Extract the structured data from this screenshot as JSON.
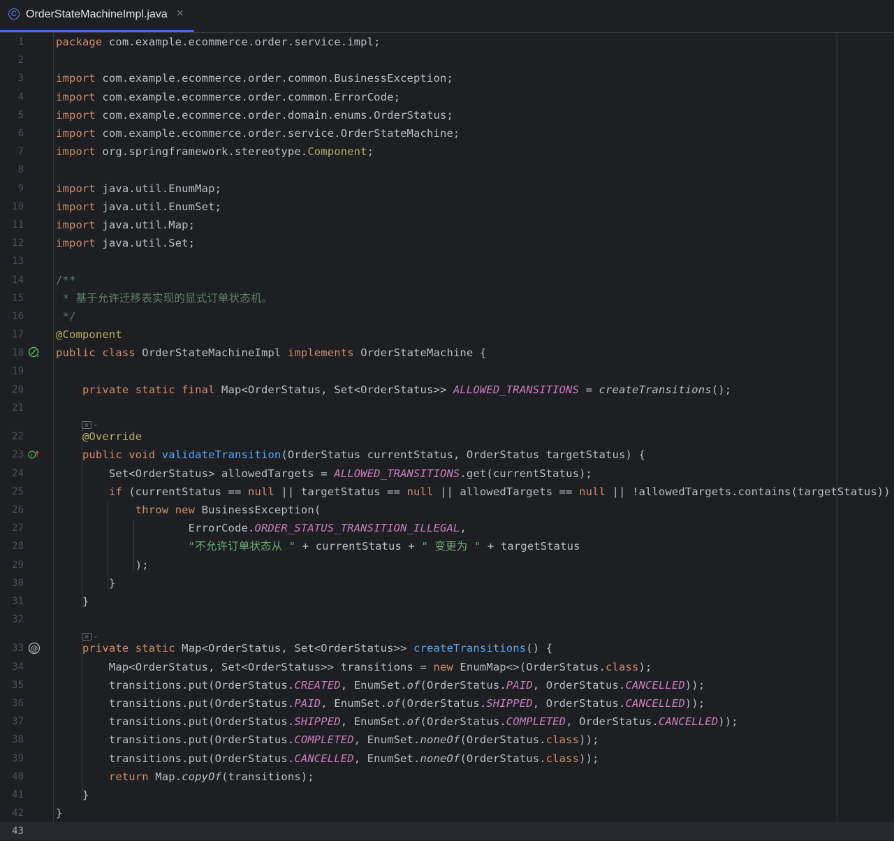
{
  "tab": {
    "icon": "C",
    "title": "OrderStateMachineImpl.java",
    "close": "×"
  },
  "editor": {
    "current_line": 43,
    "lines": [
      {
        "n": 1,
        "t": [
          [
            "kw",
            "package"
          ],
          [
            "p",
            " com.example.ecommerce.order.service.impl;"
          ]
        ]
      },
      {
        "n": 2,
        "t": []
      },
      {
        "n": 3,
        "t": [
          [
            "kw",
            "import"
          ],
          [
            "p",
            " com.example.ecommerce.order.common.BusinessException;"
          ]
        ]
      },
      {
        "n": 4,
        "t": [
          [
            "kw",
            "import"
          ],
          [
            "p",
            " com.example.ecommerce.order.common.ErrorCode;"
          ]
        ]
      },
      {
        "n": 5,
        "t": [
          [
            "kw",
            "import"
          ],
          [
            "p",
            " com.example.ecommerce.order.domain.enums.OrderStatus;"
          ]
        ]
      },
      {
        "n": 6,
        "t": [
          [
            "kw",
            "import"
          ],
          [
            "p",
            " com.example.ecommerce.order.service.OrderStateMachine;"
          ]
        ]
      },
      {
        "n": 7,
        "t": [
          [
            "kw",
            "import"
          ],
          [
            "p",
            " org.springframework.stereotype."
          ],
          [
            "ann",
            "Component"
          ],
          [
            "p",
            ";"
          ]
        ]
      },
      {
        "n": 8,
        "t": []
      },
      {
        "n": 9,
        "t": [
          [
            "kw",
            "import"
          ],
          [
            "p",
            " java.util.EnumMap;"
          ]
        ]
      },
      {
        "n": 10,
        "t": [
          [
            "kw",
            "import"
          ],
          [
            "p",
            " java.util.EnumSet;"
          ]
        ]
      },
      {
        "n": 11,
        "t": [
          [
            "kw",
            "import"
          ],
          [
            "p",
            " java.util.Map;"
          ]
        ]
      },
      {
        "n": 12,
        "t": [
          [
            "kw",
            "import"
          ],
          [
            "p",
            " java.util.Set;"
          ]
        ]
      },
      {
        "n": 13,
        "t": []
      },
      {
        "n": 14,
        "t": [
          [
            "cmt",
            "/**"
          ]
        ]
      },
      {
        "n": 15,
        "t": [
          [
            "cmt",
            " * 基于允许迁移表实现的显式订单状态机。"
          ]
        ]
      },
      {
        "n": 16,
        "t": [
          [
            "cmt",
            " */"
          ]
        ]
      },
      {
        "n": 17,
        "t": [
          [
            "ann",
            "@Component"
          ]
        ]
      },
      {
        "n": 18,
        "t": [
          [
            "kw",
            "public class"
          ],
          [
            "p",
            " OrderStateMachineImpl "
          ],
          [
            "kw",
            "implements"
          ],
          [
            "p",
            " OrderStateMachine {"
          ]
        ],
        "gutter": "bean"
      },
      {
        "n": 19,
        "t": []
      },
      {
        "n": 20,
        "t": [
          [
            "p",
            "    "
          ],
          [
            "kw",
            "private static final"
          ],
          [
            "p",
            " Map<OrderStatus, Set<OrderStatus>> "
          ],
          [
            "const",
            "ALLOWED_TRANSITIONS"
          ],
          [
            "p",
            " = "
          ],
          [
            "it",
            "createTransitions"
          ],
          [
            "p",
            "();"
          ]
        ]
      },
      {
        "n": 21,
        "t": [],
        "hint_after": true
      },
      {
        "n": 22,
        "t": [
          [
            "p",
            "    "
          ],
          [
            "ann",
            "@Override"
          ]
        ]
      },
      {
        "n": 23,
        "t": [
          [
            "p",
            "    "
          ],
          [
            "kw",
            "public void"
          ],
          [
            "p",
            " "
          ],
          [
            "fn",
            "validateTransition"
          ],
          [
            "p",
            "(OrderStatus currentStatus, OrderStatus targetStatus) {"
          ]
        ],
        "gutter": "impl"
      },
      {
        "n": 24,
        "t": [
          [
            "p",
            "        Set<OrderStatus> allowedTargets = "
          ],
          [
            "const",
            "ALLOWED_TRANSITIONS"
          ],
          [
            "p",
            ".get(currentStatus);"
          ]
        ]
      },
      {
        "n": 25,
        "t": [
          [
            "p",
            "        "
          ],
          [
            "kw",
            "if"
          ],
          [
            "p",
            " (currentStatus == "
          ],
          [
            "kw",
            "null"
          ],
          [
            "p",
            " || targetStatus == "
          ],
          [
            "kw",
            "null"
          ],
          [
            "p",
            " || allowedTargets == "
          ],
          [
            "kw",
            "null"
          ],
          [
            "p",
            " || !allowedTargets.contains(targetStatus)) {"
          ]
        ]
      },
      {
        "n": 26,
        "t": [
          [
            "p",
            "            "
          ],
          [
            "kw",
            "throw new"
          ],
          [
            "p",
            " BusinessException("
          ]
        ]
      },
      {
        "n": 27,
        "t": [
          [
            "p",
            "                    ErrorCode."
          ],
          [
            "const",
            "ORDER_STATUS_TRANSITION_ILLEGAL"
          ],
          [
            "p",
            ","
          ]
        ]
      },
      {
        "n": 28,
        "t": [
          [
            "p",
            "                    "
          ],
          [
            "str",
            "\"不允许订单状态从 \""
          ],
          [
            "p",
            " + currentStatus + "
          ],
          [
            "str",
            "\" 变更为 \""
          ],
          [
            "p",
            " + targetStatus"
          ]
        ]
      },
      {
        "n": 29,
        "t": [
          [
            "p",
            "            );"
          ]
        ]
      },
      {
        "n": 30,
        "t": [
          [
            "p",
            "        }"
          ]
        ]
      },
      {
        "n": 31,
        "t": [
          [
            "p",
            "    }"
          ]
        ]
      },
      {
        "n": 32,
        "t": [],
        "hint_after": true
      },
      {
        "n": 33,
        "t": [
          [
            "p",
            "    "
          ],
          [
            "kw",
            "private static"
          ],
          [
            "p",
            " Map<OrderStatus, Set<OrderStatus>> "
          ],
          [
            "fn",
            "createTransitions"
          ],
          [
            "p",
            "() {"
          ]
        ],
        "gutter": "at"
      },
      {
        "n": 34,
        "t": [
          [
            "p",
            "        Map<OrderStatus, Set<OrderStatus>> transitions = "
          ],
          [
            "kw",
            "new"
          ],
          [
            "p",
            " EnumMap<>(OrderStatus."
          ],
          [
            "kw",
            "class"
          ],
          [
            "p",
            ");"
          ]
        ]
      },
      {
        "n": 35,
        "t": [
          [
            "p",
            "        transitions.put(OrderStatus."
          ],
          [
            "const",
            "CREATED"
          ],
          [
            "p",
            ", EnumSet."
          ],
          [
            "it",
            "of"
          ],
          [
            "p",
            "(OrderStatus."
          ],
          [
            "const",
            "PAID"
          ],
          [
            "p",
            ", OrderStatus."
          ],
          [
            "const",
            "CANCELLED"
          ],
          [
            "p",
            "));"
          ]
        ]
      },
      {
        "n": 36,
        "t": [
          [
            "p",
            "        transitions.put(OrderStatus."
          ],
          [
            "const",
            "PAID"
          ],
          [
            "p",
            ", EnumSet."
          ],
          [
            "it",
            "of"
          ],
          [
            "p",
            "(OrderStatus."
          ],
          [
            "const",
            "SHIPPED"
          ],
          [
            "p",
            ", OrderStatus."
          ],
          [
            "const",
            "CANCELLED"
          ],
          [
            "p",
            "));"
          ]
        ]
      },
      {
        "n": 37,
        "t": [
          [
            "p",
            "        transitions.put(OrderStatus."
          ],
          [
            "const",
            "SHIPPED"
          ],
          [
            "p",
            ", EnumSet."
          ],
          [
            "it",
            "of"
          ],
          [
            "p",
            "(OrderStatus."
          ],
          [
            "const",
            "COMPLETED"
          ],
          [
            "p",
            ", OrderStatus."
          ],
          [
            "const",
            "CANCELLED"
          ],
          [
            "p",
            "));"
          ]
        ]
      },
      {
        "n": 38,
        "t": [
          [
            "p",
            "        transitions.put(OrderStatus."
          ],
          [
            "const",
            "COMPLETED"
          ],
          [
            "p",
            ", EnumSet."
          ],
          [
            "it",
            "noneOf"
          ],
          [
            "p",
            "(OrderStatus."
          ],
          [
            "kw",
            "class"
          ],
          [
            "p",
            "));"
          ]
        ]
      },
      {
        "n": 39,
        "t": [
          [
            "p",
            "        transitions.put(OrderStatus."
          ],
          [
            "const",
            "CANCELLED"
          ],
          [
            "p",
            ", EnumSet."
          ],
          [
            "it",
            "noneOf"
          ],
          [
            "p",
            "(OrderStatus."
          ],
          [
            "kw",
            "class"
          ],
          [
            "p",
            "));"
          ]
        ]
      },
      {
        "n": 40,
        "t": [
          [
            "p",
            "        "
          ],
          [
            "kw",
            "return"
          ],
          [
            "p",
            " Map."
          ],
          [
            "it",
            "copyOf"
          ],
          [
            "p",
            "(transitions);"
          ]
        ]
      },
      {
        "n": 41,
        "t": [
          [
            "p",
            "    }"
          ]
        ]
      },
      {
        "n": 42,
        "t": [
          [
            "p",
            "}"
          ]
        ]
      },
      {
        "n": 43,
        "t": []
      }
    ]
  },
  "colors": {
    "background": "#1e1f22",
    "keyword": "#cf8e6d",
    "annotation": "#b3ae60",
    "comment": "#5f826b",
    "string": "#6aab73",
    "constant": "#c77dbb",
    "function": "#56a8f5",
    "accent": "#3574f0"
  }
}
